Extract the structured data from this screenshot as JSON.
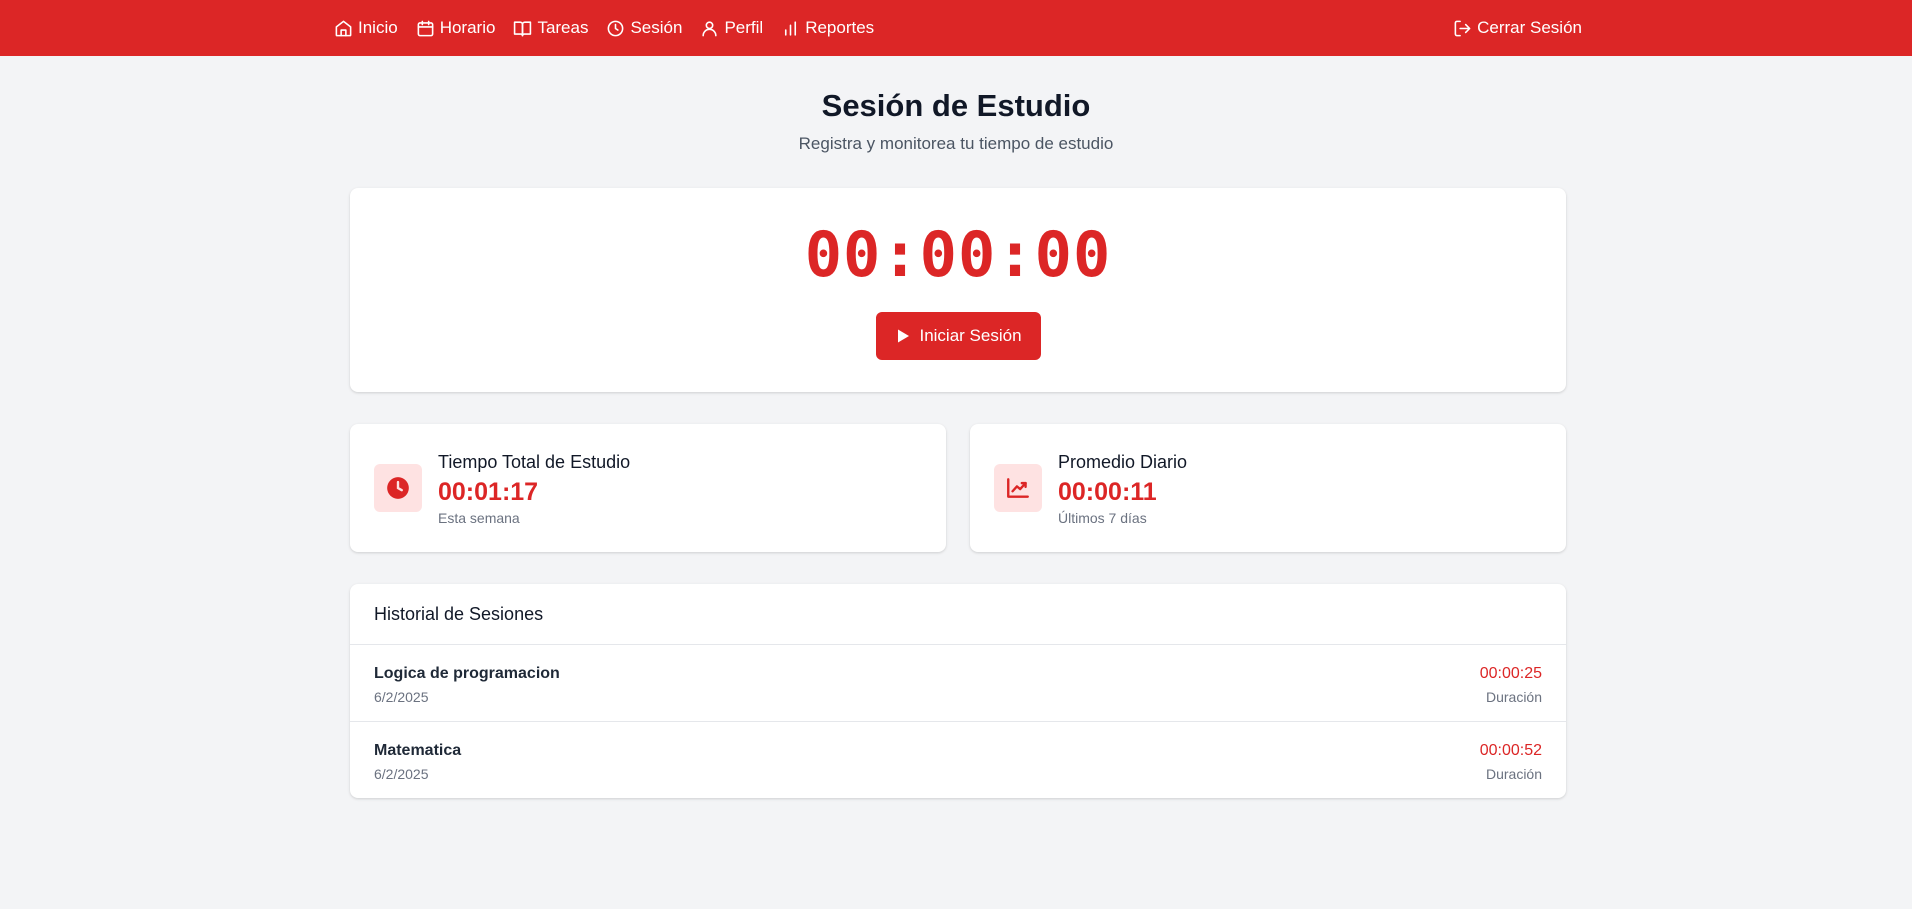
{
  "nav": {
    "items": [
      {
        "label": "Inicio",
        "icon": "home-icon"
      },
      {
        "label": "Horario",
        "icon": "calendar-icon"
      },
      {
        "label": "Tareas",
        "icon": "book-icon"
      },
      {
        "label": "Sesión",
        "icon": "clock-icon"
      },
      {
        "label": "Perfil",
        "icon": "user-icon"
      },
      {
        "label": "Reportes",
        "icon": "bar-chart-icon"
      }
    ],
    "logout": {
      "label": "Cerrar Sesión",
      "icon": "logout-icon"
    }
  },
  "header": {
    "title": "Sesión de Estudio",
    "subtitle": "Registra y monitorea tu tiempo de estudio"
  },
  "timer": {
    "display": "00:00:00",
    "start_label": "Iniciar Sesión"
  },
  "stats": [
    {
      "title": "Tiempo Total de Estudio",
      "value": "00:01:17",
      "sub": "Esta semana",
      "icon": "clock-icon"
    },
    {
      "title": "Promedio Diario",
      "value": "00:00:11",
      "sub": "Últimos 7 días",
      "icon": "trending-up-icon"
    }
  ],
  "history": {
    "title": "Historial de Sesiones",
    "sessions": [
      {
        "name": "Logica de programacion",
        "date": "6/2/2025",
        "duration": "00:00:25",
        "duration_label": "Duración"
      },
      {
        "name": "Matematica",
        "date": "6/2/2025",
        "duration": "00:00:52",
        "duration_label": "Duración"
      }
    ]
  },
  "colors": {
    "accent": "#dc2626",
    "background": "#f3f4f6",
    "icon_bg": "#fee2e2"
  }
}
